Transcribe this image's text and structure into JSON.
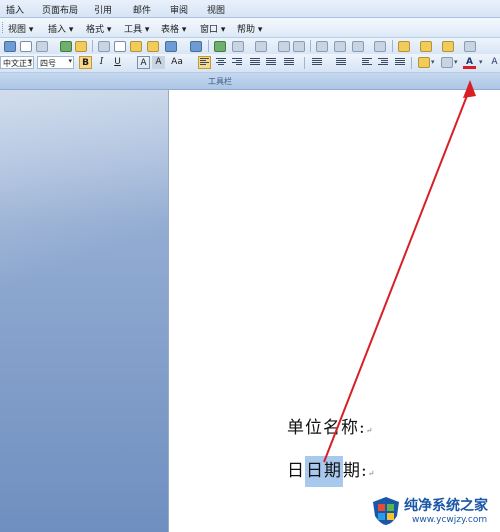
{
  "ribbon": {
    "tabs": [
      "插入",
      "页面布局",
      "引用",
      "邮件",
      "审阅",
      "视图"
    ]
  },
  "menubar": {
    "items": [
      "视图 ▾",
      "插入 ▾",
      "格式 ▾",
      "工具 ▾",
      "表格 ▾",
      "窗口 ▾",
      "帮助 ▾"
    ]
  },
  "format_toolbar": {
    "font_name": "中文正3",
    "font_size": "四号",
    "bold": "B",
    "italic": "I",
    "underline": "U",
    "char_border": "A",
    "char_shading": "A",
    "change_case": "Aa",
    "font_color": "A"
  },
  "toolbar_strip_label": "工具栏",
  "document": {
    "line1": "单位名称:",
    "line2_before": "日",
    "line2_selected": "日期",
    "line2_after": "期:",
    "paragraph_mark": "↵"
  },
  "watermark": {
    "brand": "纯净系统之家",
    "url": "www.ycwjzy.com"
  },
  "colors": {
    "accent": "#d81f26",
    "selection": "#a9c8ee",
    "ribbon": "#d6e4f5"
  }
}
